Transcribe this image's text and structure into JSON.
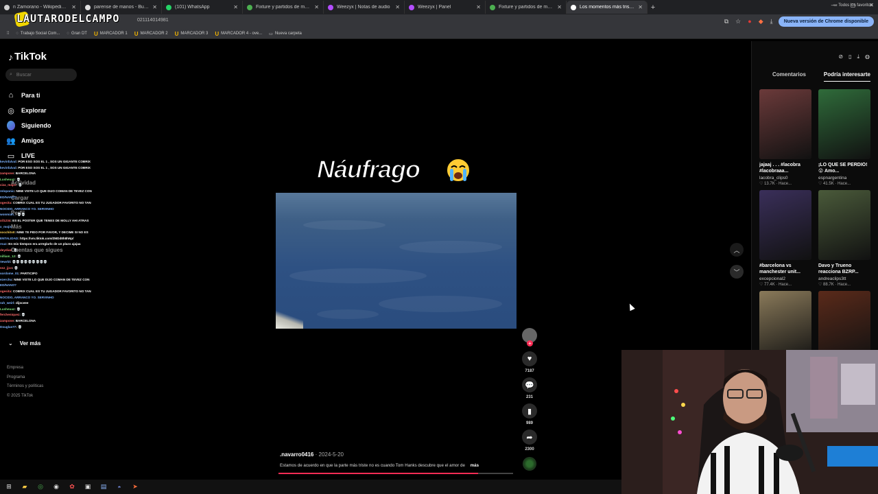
{
  "browser": {
    "tabs": [
      {
        "title": "n Zamorano - Wikipedia, la",
        "color": "#d0d0d0"
      },
      {
        "title": "parense de manos - Buscar co",
        "color": "#e0e0e0"
      },
      {
        "title": "(101) WhatsApp",
        "color": "#25d366"
      },
      {
        "title": "Fixture y partidos de mañana e",
        "color": "#4caf50"
      },
      {
        "title": "Weezyx | Notas de audio",
        "color": "#b34dff"
      },
      {
        "title": "Weezyx | Panel",
        "color": "#b34dff"
      },
      {
        "title": "Fixture y partidos de mañana e",
        "color": "#4caf50"
      },
      {
        "title": "Los momentos más tristes",
        "color": "#ffffff",
        "active": true
      }
    ],
    "url_fragment": "021114014981",
    "chrome_update": "Nueva versión de Chrome disponible",
    "bookmarks": [
      "Trabajo Social Com...",
      "Gran DT",
      "MARCADOR 1",
      "MARCADOR 2",
      "MARCADOR 3",
      "MARCADOR 4 - ove...",
      "Nueva carpeta"
    ],
    "all_bookmarks": "Todos los favoritos"
  },
  "overlay": {
    "brand": "LAUTARODELCAMPO"
  },
  "tiktok": {
    "logo": "TikTok",
    "search_placeholder": "Buscar",
    "nav": [
      {
        "label": "Para ti",
        "icon": "home-icon"
      },
      {
        "label": "Explorar",
        "icon": "compass-icon"
      },
      {
        "label": "Siguiendo",
        "icon": "following-icon"
      },
      {
        "label": "Amigos",
        "icon": "friends-icon"
      },
      {
        "label": "LIVE",
        "icon": "live-icon"
      }
    ],
    "ghost_nav": [
      "Actividad",
      "Cargar",
      "Perfil",
      "Más",
      "Cuentas que sigues"
    ],
    "ver_mas": "Ver más",
    "footer": [
      "Empresa",
      "Programa",
      "Términos y políticas",
      "© 2025 TikTok"
    ],
    "video": {
      "title": "Náufrago",
      "author": ".navarro0416",
      "date": "2024-5-20",
      "caption": "Estamos de acuerdo en que la parte más triste no es cuando Tom Hanks descubre que el amor de",
      "more": "más",
      "progress": 0.85
    },
    "actions": {
      "likes": "7187",
      "comments": "231",
      "saves": "989",
      "shares": "2300"
    },
    "panel": {
      "tabs": [
        "Comentarios",
        "Podría interesarte"
      ],
      "active_tab": 1,
      "cards": [
        {
          "title": "jajaaj . . . #lacobra #lacobraaa...",
          "author": "lacobra_clips0",
          "meta": "13.7K · Hace...",
          "thumb": "#6b3a3a"
        },
        {
          "title": "¡LO QUE SE PERDIÓ! 😮 Amo...",
          "author": "espnargentina",
          "meta": "41.5K · Hace...",
          "thumb": "#2f6b3a"
        },
        {
          "title": "#barcelona vs manchester unit...",
          "author": "excepcional2",
          "meta": "77.4K · Hace...",
          "thumb": "#3a2f5a"
        },
        {
          "title": "Davo y Trueno reacciona BZRP...",
          "author": "andreaclips3tt",
          "meta": "88.7K · Hace...",
          "thumb": "#4a5a3a"
        },
        {
          "title": "",
          "author": "",
          "meta": "",
          "thumb": "#8a7a5a"
        },
        {
          "title": "",
          "author": "",
          "meta": "",
          "thumb": "#5a2a1a"
        }
      ]
    }
  },
  "chat": [
    {
      "user": "kevinfalval",
      "msg": "POR ESO SOS EL 1 , SOS UN GIGANTE COBRIX",
      "c": ""
    },
    {
      "user": "kevinfalval",
      "msg": "POR ESO SOS EL 1 , SOS UN GIGANTE COBRIX",
      "c": ""
    },
    {
      "user": "zampone",
      "msg": "BARCELONA",
      "c": "r"
    },
    {
      "user": "Lusheuaz",
      "msg": "💀",
      "c": "g"
    },
    {
      "user": "ciza_major",
      "msg": "💀",
      "c": "r"
    },
    {
      "user": "reloponic",
      "msg": "NINE VISTE LO QUE DIJO COMAN DE TEVEZ CON",
      "c": ""
    },
    {
      "user": "ED/NANO?",
      "msg": "",
      "c": ""
    },
    {
      "user": "ogesita",
      "msg": "COBRIX CUAL ES TU JUGADOR FAVORITO NO TAN",
      "c": "r"
    },
    {
      "user": "NOCIDO, ARRANCO YO. SERVINHO",
      "msg": "",
      "c": ""
    },
    {
      "user": "wonmiah_",
      "msg": "💀💀",
      "c": ""
    },
    {
      "user": "xil1234",
      "msg": "ES EL POSTER QUE TENES DE MOLLY AHI ATRAS",
      "c": "r"
    },
    {
      "user": "x_mojis",
      "msg": "",
      "c": ""
    },
    {
      "user": "socchito0",
      "msg": "NINE TE PIDO POR FAVOR, Y DECIME SI NO ES",
      "c": "y"
    },
    {
      "user": "ENTALIDAD",
      "msg": "https://vm.tiktok.com/ZMDd8h8hNp/",
      "c": ""
    },
    {
      "user": "rsuz",
      "msg": "En mis tiempos era arreglarlo de un plazo ajajaa",
      "c": ""
    },
    {
      "user": "deydiaz",
      "msg": "💀",
      "c": "r"
    },
    {
      "user": "nilliam_12",
      "msg": "💀",
      "c": "g"
    },
    {
      "user": "Vewrbl",
      "msg": "💀💀💀💀💀💀💀💀💀",
      "c": ""
    },
    {
      "user": "ssz_jjco",
      "msg": "💀",
      "c": "r"
    },
    {
      "user": "sordome_01",
      "msg": "PARTICIPO",
      "c": ""
    },
    {
      "user": "ezerchu",
      "msg": "NINE VISTE LO QUE DIJO COMAN DE TEVEZ CON",
      "c": ""
    },
    {
      "user": "ED/NANO?",
      "msg": "",
      "c": ""
    },
    {
      "user": "ogesita",
      "msg": "COBRIX CUAL ES TU JUGADOR FAVORITO NO TAN",
      "c": "r"
    },
    {
      "user": "NOCIDO, ARRANCO YO. SERVINHO",
      "msg": "",
      "c": ""
    },
    {
      "user": "rah_weirl",
      "msg": "dijoceee",
      "c": ""
    },
    {
      "user": "Lusheuaz",
      "msg": "💀",
      "c": "g"
    },
    {
      "user": "fercheniquez",
      "msg": "💀",
      "c": "r"
    },
    {
      "user": "zampone",
      "msg": "BARCELONA",
      "c": "r"
    },
    {
      "user": "Douglas77",
      "msg": "💀",
      "c": ""
    }
  ]
}
